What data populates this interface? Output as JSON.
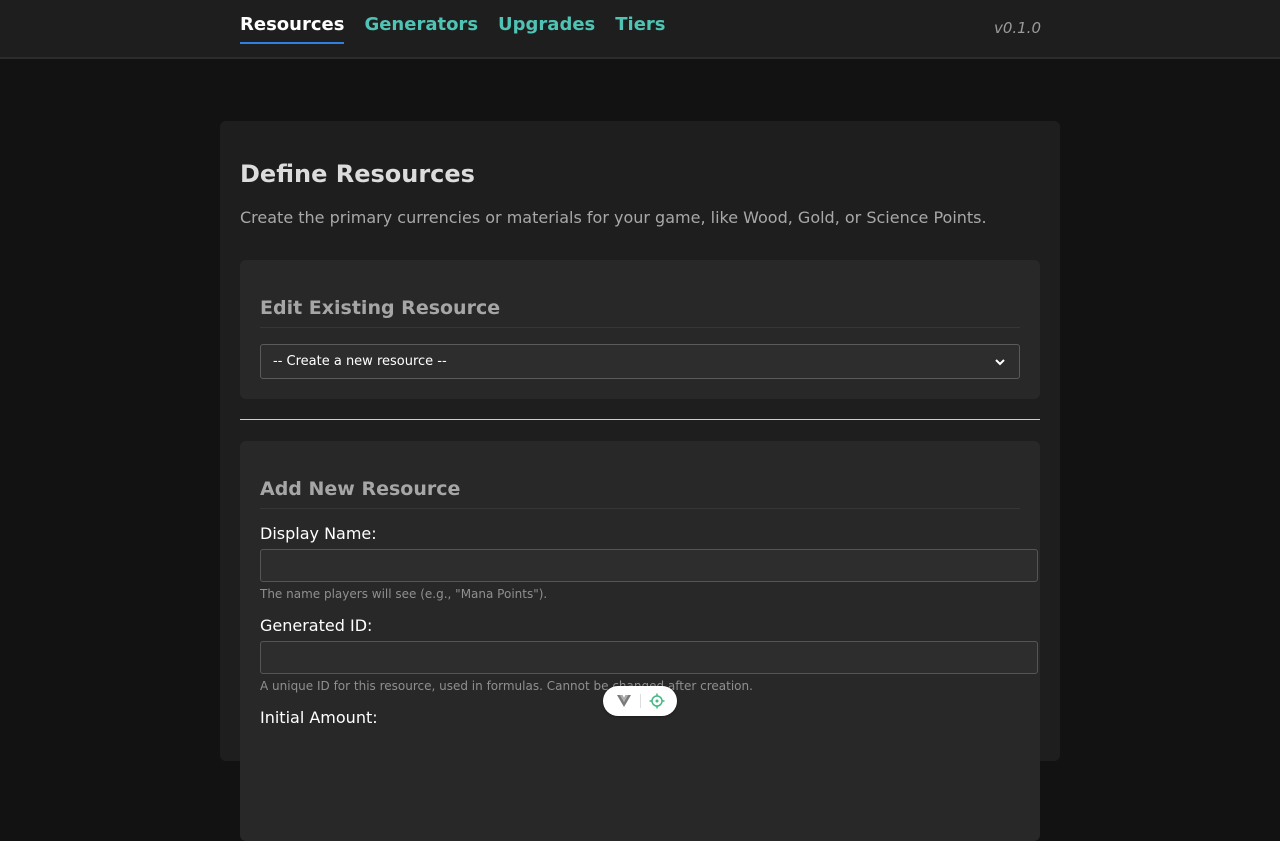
{
  "nav": {
    "tabs": [
      {
        "label": "Resources"
      },
      {
        "label": "Generators"
      },
      {
        "label": "Upgrades"
      },
      {
        "label": "Tiers"
      }
    ],
    "version": "v0.1.0"
  },
  "page": {
    "title": "Define Resources",
    "description": "Create the primary currencies or materials for your game, like Wood, Gold, or Science Points."
  },
  "edit_section": {
    "title": "Edit Existing Resource",
    "selected_option": "-- Create a new resource --"
  },
  "add_section": {
    "title": "Add New Resource",
    "display_name": {
      "label": "Display Name:",
      "value": "",
      "hint": "The name players will see (e.g., \"Mana Points\")."
    },
    "generated_id": {
      "label": "Generated ID:",
      "value": "",
      "hint": "A unique ID for this resource, used in formulas. Cannot be changed after creation."
    },
    "initial_amount": {
      "label": "Initial Amount:"
    }
  },
  "floating_toolbar": {
    "icons": [
      "vue-logo-icon",
      "inspect-target-icon"
    ]
  },
  "colors": {
    "background": "#121212",
    "topbar": "#1e1e1e",
    "panel": "#1e1e1e",
    "card": "#282828",
    "nav_link": "#4fc3b4",
    "active_underline": "#2f7fe0"
  }
}
